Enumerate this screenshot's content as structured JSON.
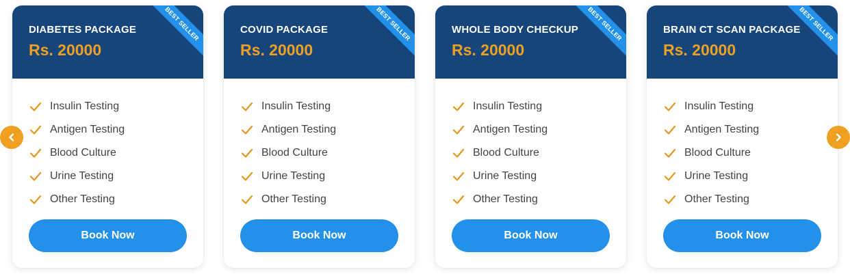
{
  "cards": [
    {
      "title": "DIABETES PACKAGE",
      "price": "Rs. 20000",
      "ribbon": "BEST SELLER",
      "features": [
        "Insulin Testing",
        "Antigen Testing",
        "Blood Culture",
        "Urine Testing",
        "Other Testing"
      ],
      "button": "Book Now"
    },
    {
      "title": "COVID PACKAGE",
      "price": "Rs. 20000",
      "ribbon": "BEST SELLER",
      "features": [
        "Insulin Testing",
        "Antigen Testing",
        "Blood Culture",
        "Urine Testing",
        "Other Testing"
      ],
      "button": "Book Now"
    },
    {
      "title": "WHOLE BODY CHECKUP",
      "price": "Rs. 20000",
      "ribbon": "BEST SELLER",
      "features": [
        "Insulin Testing",
        "Antigen Testing",
        "Blood Culture",
        "Urine Testing",
        "Other Testing"
      ],
      "button": "Book Now"
    },
    {
      "title": "BRAIN CT SCAN PACKAGE",
      "price": "Rs. 20000",
      "ribbon": "BEST SELLER",
      "features": [
        "Insulin Testing",
        "Antigen Testing",
        "Blood Culture",
        "Urine Testing",
        "Other Testing"
      ],
      "button": "Book Now"
    }
  ],
  "navigation": {
    "prev_icon": "chevron-left-icon",
    "next_icon": "chevron-right-icon"
  },
  "colors": {
    "header_bg": "#16457c",
    "price": "#f0a021",
    "accent_blue": "#2391ea",
    "check": "#e6961e",
    "nav_bg": "#f0a021"
  }
}
